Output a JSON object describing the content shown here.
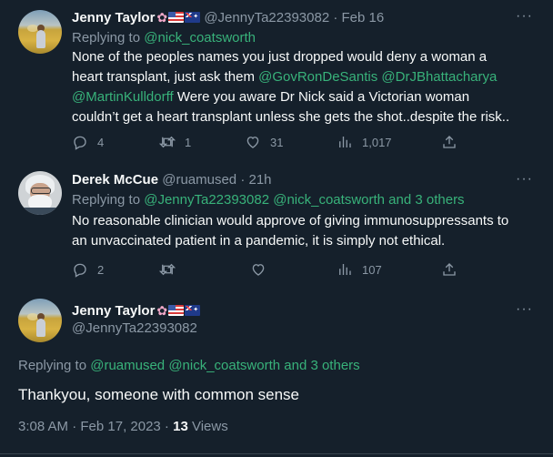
{
  "tweet1": {
    "name": "Jenny Taylor",
    "handle": "@JennyTa22393082",
    "time": "Feb 16",
    "replying_label": "Replying to",
    "replying_to": "@nick_coatsworth",
    "text1": "None of the peoples names you just dropped would deny a woman a",
    "text2": "heart transplant, just ask them",
    "mention1": "@GovRonDeSantis",
    "mention2": "@DrJBhattacharya",
    "mention3": "@MartinKulldorff",
    "text3": "Were you aware Dr Nick said a Victorian woman",
    "text4": "couldn’t get a heart transplant unless she gets the shot..despite the risk..",
    "replies": "4",
    "retweets": "1",
    "likes": "31",
    "views": "1,017"
  },
  "tweet2": {
    "name": "Derek McCue",
    "handle": "@ruamused",
    "time": "21h",
    "replying_label": "Replying to",
    "replying_to": "@JennyTa22393082 @nick_coatsworth and 3 others",
    "text1": "No reasonable clinician would approve of giving immunosuppressants to",
    "text2": "an unvaccinated patient in a pandemic, it is simply not ethical.",
    "replies": "2",
    "retweets": "",
    "likes": "",
    "views": "107"
  },
  "focus": {
    "name": "Jenny Taylor",
    "handle": "@JennyTa22393082",
    "replying_label": "Replying to",
    "replying_to": "@ruamused @nick_coatsworth and 3 others",
    "text": "Thankyou, someone with common sense",
    "timestamp": "3:08 AM · Feb 17, 2023 · ",
    "views_count": "13",
    "views_label": "Views"
  },
  "icons": {
    "more": "more-icon",
    "reply": "reply-icon",
    "retweet": "retweet-icon",
    "like": "like-icon",
    "views": "views-icon",
    "share": "share-icon",
    "flower": "flower-emoji",
    "flag_us": "us-flag",
    "flag_au": "au-flag"
  },
  "colors": {
    "background": "#15202b",
    "link": "#1d9bf0",
    "replying_link": "#38b27a",
    "muted": "#8b98a5"
  }
}
